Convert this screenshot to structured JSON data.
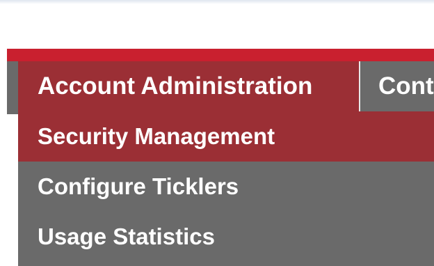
{
  "nav": {
    "tabs": [
      {
        "label": "Account Administration",
        "active": true
      },
      {
        "label": "Cont",
        "active": false
      }
    ]
  },
  "dropdown": {
    "items": [
      {
        "label": "Security Management",
        "highlighted": true
      },
      {
        "label": "Configure Ticklers",
        "highlighted": false
      },
      {
        "label": "Usage Statistics",
        "highlighted": false
      }
    ]
  },
  "colors": {
    "accent_red": "#c9202f",
    "active_tab": "#9b2f35",
    "nav_gray": "#6a6a6a",
    "text": "#ffffff"
  }
}
